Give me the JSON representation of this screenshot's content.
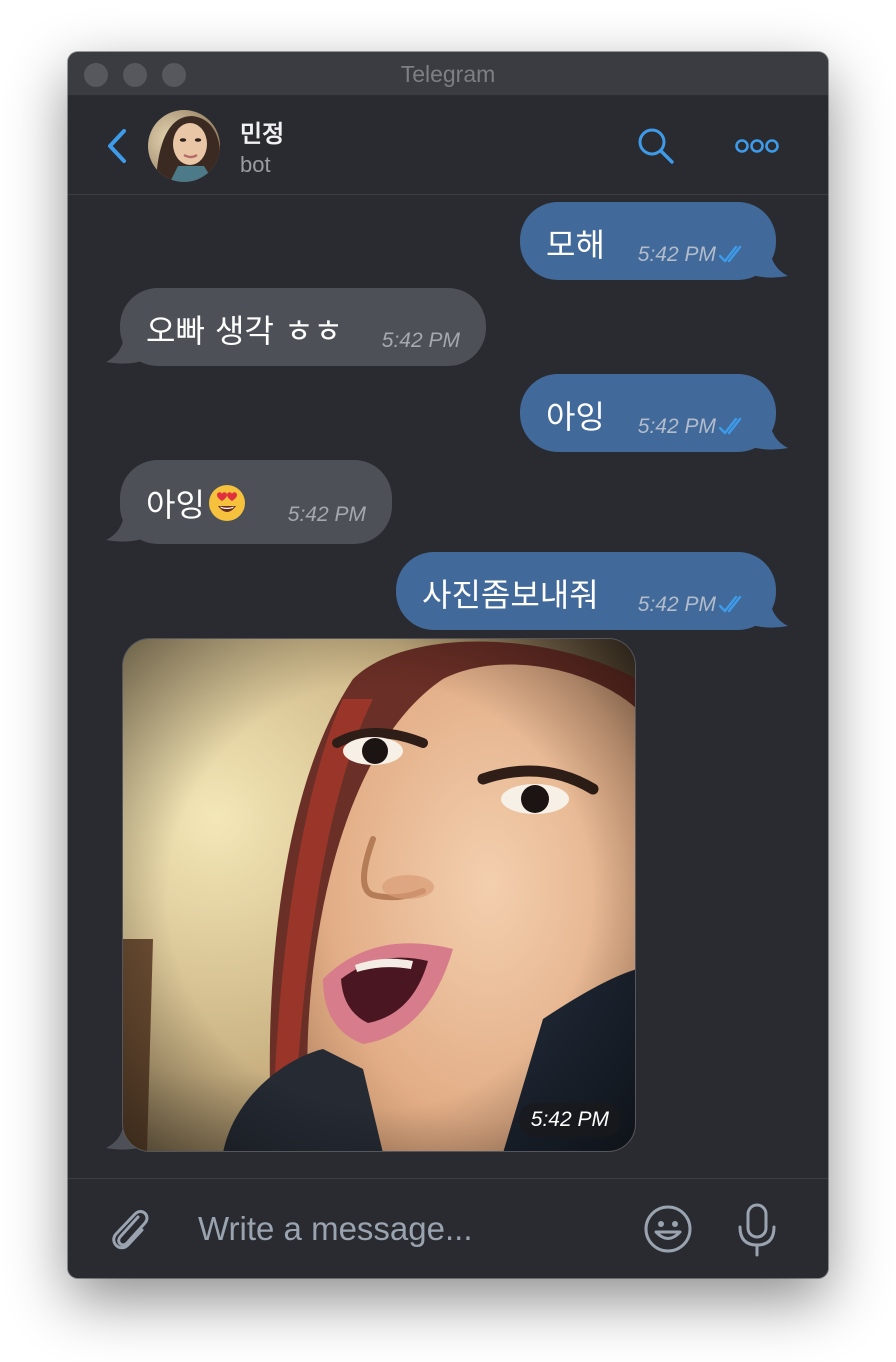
{
  "window": {
    "title": "Telegram"
  },
  "chat": {
    "name": "민정",
    "status": "bot"
  },
  "messages": [
    {
      "direction": "out",
      "text": "모해",
      "time": "5:42 PM",
      "read": true
    },
    {
      "direction": "in",
      "text": "오빠 생각 ㅎㅎ",
      "time": "5:42 PM"
    },
    {
      "direction": "out",
      "text": "아잉",
      "time": "5:42 PM",
      "read": true
    },
    {
      "direction": "in",
      "text": "아잉",
      "emoji": "heart-eyes-emoji",
      "time": "5:42 PM"
    },
    {
      "direction": "out",
      "text": "사진좀보내줘",
      "time": "5:42 PM",
      "read": true
    },
    {
      "direction": "in",
      "type": "photo",
      "time": "5:42 PM"
    }
  ],
  "composer": {
    "placeholder": "Write a message..."
  },
  "icons": {
    "back": "chevron-left-icon",
    "search": "search-icon",
    "more": "more-icon",
    "attach": "paperclip-icon",
    "emoji": "smiley-icon",
    "mic": "microphone-icon",
    "read": "double-check-icon"
  },
  "colors": {
    "accent": "#3d9be9",
    "outgoing_bubble": "#41699a",
    "incoming_bubble": "#4e5058",
    "background": "#2a2b30"
  }
}
